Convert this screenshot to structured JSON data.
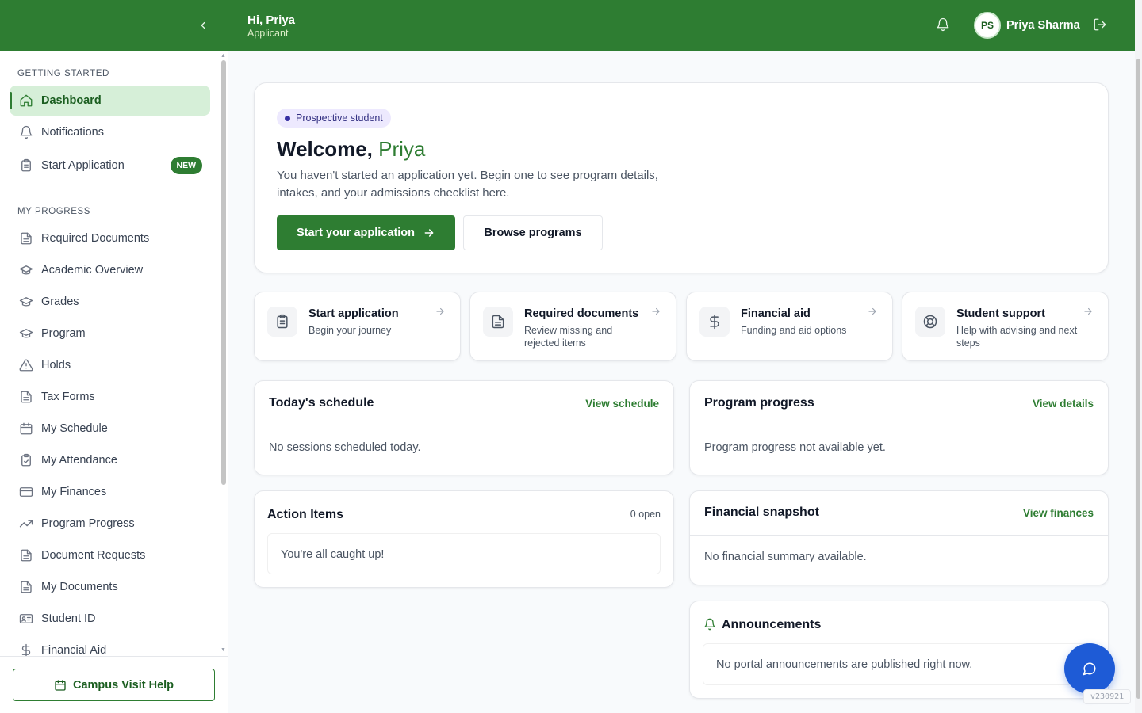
{
  "topbar": {
    "greeting": "Hi, Priya",
    "role": "Applicant",
    "user_initials": "PS",
    "user_name": "Priya Sharma"
  },
  "sidebar": {
    "sections": [
      {
        "label": "GETTING STARTED"
      },
      {
        "label": "MY PROGRESS"
      }
    ],
    "items": [
      {
        "label": "Dashboard",
        "icon": "home-icon",
        "active": true
      },
      {
        "label": "Notifications",
        "icon": "bell-icon"
      },
      {
        "label": "Start Application",
        "icon": "clipboard-icon",
        "badge": "NEW"
      },
      {
        "label": "Required Documents",
        "icon": "document-icon"
      },
      {
        "label": "Academic Overview",
        "icon": "graduation-cap-icon"
      },
      {
        "label": "Grades",
        "icon": "graduation-cap-icon"
      },
      {
        "label": "Program",
        "icon": "graduation-cap-icon"
      },
      {
        "label": "Holds",
        "icon": "warning-icon"
      },
      {
        "label": "Tax Forms",
        "icon": "document-icon"
      },
      {
        "label": "My Schedule",
        "icon": "calendar-icon"
      },
      {
        "label": "My Attendance",
        "icon": "clipboard-check-icon"
      },
      {
        "label": "My Finances",
        "icon": "credit-card-icon"
      },
      {
        "label": "Program Progress",
        "icon": "trending-up-icon"
      },
      {
        "label": "Document Requests",
        "icon": "document-icon"
      },
      {
        "label": "My Documents",
        "icon": "document-icon"
      },
      {
        "label": "Student ID",
        "icon": "id-card-icon"
      },
      {
        "label": "Financial Aid",
        "icon": "dollar-icon"
      }
    ],
    "footer_button": "Campus Visit Help"
  },
  "hero": {
    "chip": "Prospective student",
    "welcome": "Welcome,",
    "name": "Priya",
    "description": "You haven't started an application yet. Begin one to see program details, intakes, and your admissions checklist here.",
    "primary_button": "Start your application",
    "secondary_button": "Browse programs"
  },
  "quick_links": [
    {
      "title": "Start application",
      "subtitle": "Begin your journey",
      "icon": "clipboard-icon"
    },
    {
      "title": "Required documents",
      "subtitle": "Review missing and rejected items",
      "icon": "document-icon"
    },
    {
      "title": "Financial aid",
      "subtitle": "Funding and aid options",
      "icon": "dollar-icon"
    },
    {
      "title": "Student support",
      "subtitle": "Help with advising and next steps",
      "icon": "lifebuoy-icon"
    }
  ],
  "schedule": {
    "title": "Today's schedule",
    "link": "View schedule",
    "empty": "No sessions scheduled today."
  },
  "program_progress": {
    "title": "Program progress",
    "link": "View details",
    "empty": "Program progress not available yet."
  },
  "action_items": {
    "title": "Action Items",
    "count": "0 open",
    "empty": "You're all caught up!"
  },
  "financial_snapshot": {
    "title": "Financial snapshot",
    "link": "View finances",
    "empty": "No financial summary available."
  },
  "announcements": {
    "title": "Announcements",
    "empty": "No portal announcements are published right now."
  },
  "version": "v230921",
  "colors": {
    "brand": "#2e7d32",
    "active_bg": "#d6efd8",
    "chip_bg": "#ede9fe",
    "fab": "#1e5bd6"
  }
}
